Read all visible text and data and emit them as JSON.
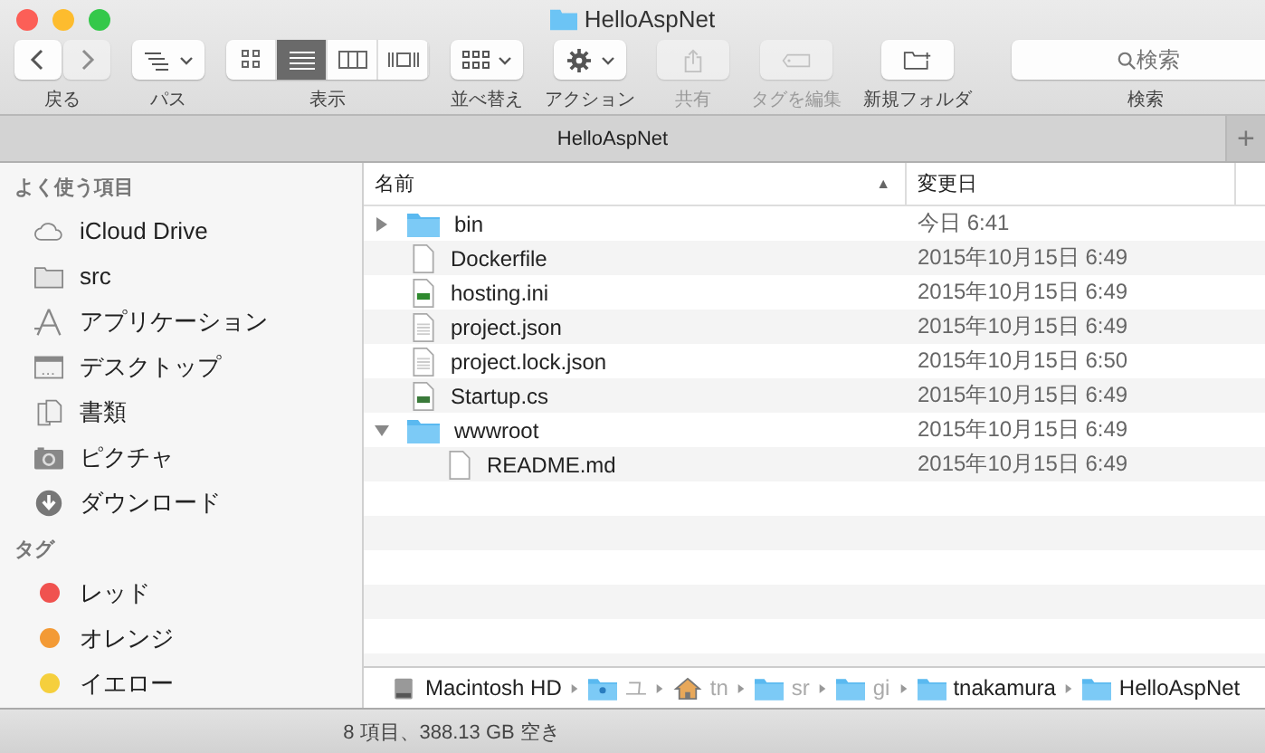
{
  "window": {
    "title": "HelloAspNet"
  },
  "toolbar": [
    {
      "kind": "nav",
      "label": "戻る",
      "back_disabled": false,
      "forward_disabled": true
    },
    {
      "kind": "menu",
      "label": "パス",
      "disabled": false
    },
    {
      "kind": "view",
      "label": "表示",
      "options": [
        {
          "selected": false
        },
        {
          "selected": true
        },
        {
          "selected": false
        },
        {
          "selected": false
        }
      ]
    },
    {
      "kind": "menu",
      "label": "並べ替え",
      "disabled": false
    },
    {
      "kind": "menu",
      "label": "アクション",
      "disabled": false
    },
    {
      "kind": "button",
      "label": "共有",
      "disabled": true
    },
    {
      "kind": "button",
      "label": "タグを編集",
      "disabled": true
    },
    {
      "kind": "button",
      "label": "新規フォルダ",
      "disabled": false
    },
    {
      "kind": "search",
      "placeholder": "検索",
      "label": "検索"
    }
  ],
  "tab": {
    "title": "HelloAspNet",
    "add": "+"
  },
  "sidebar": [
    {
      "heading": "よく使う項目",
      "items": [
        {
          "kind": "cloud",
          "label": "iCloud Drive"
        },
        {
          "kind": "folder",
          "label": "src"
        },
        {
          "kind": "apps",
          "label": "アプリケーション"
        },
        {
          "kind": "desktop",
          "label": "デスクトップ"
        },
        {
          "kind": "documents",
          "label": "書類"
        },
        {
          "kind": "camera",
          "label": "ピクチャ"
        },
        {
          "kind": "download",
          "label": "ダウンロード"
        }
      ]
    },
    {
      "heading": "タグ",
      "items": [
        {
          "kind": "tag",
          "label": "レッド",
          "color": "#f0524f"
        },
        {
          "kind": "tag",
          "label": "オレンジ",
          "color": "#f39a35"
        },
        {
          "kind": "tag",
          "label": "イエロー",
          "color": "#f5cf3d"
        }
      ]
    }
  ],
  "table": {
    "columns": [
      {
        "label": "名前",
        "sort": "▲"
      },
      {
        "label": "変更日"
      }
    ],
    "rows": [
      {
        "kind": "folder",
        "name": "bin",
        "date": "今日 6:41",
        "expanded": false
      },
      {
        "kind": "file",
        "name": "Dockerfile",
        "date": "2015年10月15日 6:49"
      },
      {
        "kind": "ini",
        "name": "hosting.ini",
        "date": "2015年10月15日 6:49"
      },
      {
        "kind": "text",
        "name": "project.json",
        "date": "2015年10月15日 6:49"
      },
      {
        "kind": "text",
        "name": "project.lock.json",
        "date": "2015年10月15日 6:50"
      },
      {
        "kind": "cs",
        "name": "Startup.cs",
        "date": "2015年10月15日 6:49"
      },
      {
        "kind": "folder",
        "name": "wwwroot",
        "date": "2015年10月15日 6:49",
        "expanded": true,
        "children": [
          {
            "kind": "file",
            "name": "README.md",
            "date": "2015年10月15日 6:49"
          }
        ]
      }
    ]
  },
  "path_bar": [
    {
      "kind": "disk",
      "label": "Macintosh HD",
      "faded": false
    },
    {
      "kind": "users",
      "label": "ユ",
      "faded": true
    },
    {
      "kind": "home",
      "label": "tn",
      "faded": true
    },
    {
      "kind": "folder",
      "label": "sr",
      "faded": true
    },
    {
      "kind": "folder",
      "label": "gi",
      "faded": true
    },
    {
      "kind": "folder",
      "label": "tnakamura",
      "faded": false
    },
    {
      "kind": "folder",
      "label": "HelloAspNet",
      "faded": false
    }
  ],
  "status_bar": "8 項目、388.13 GB 空き"
}
